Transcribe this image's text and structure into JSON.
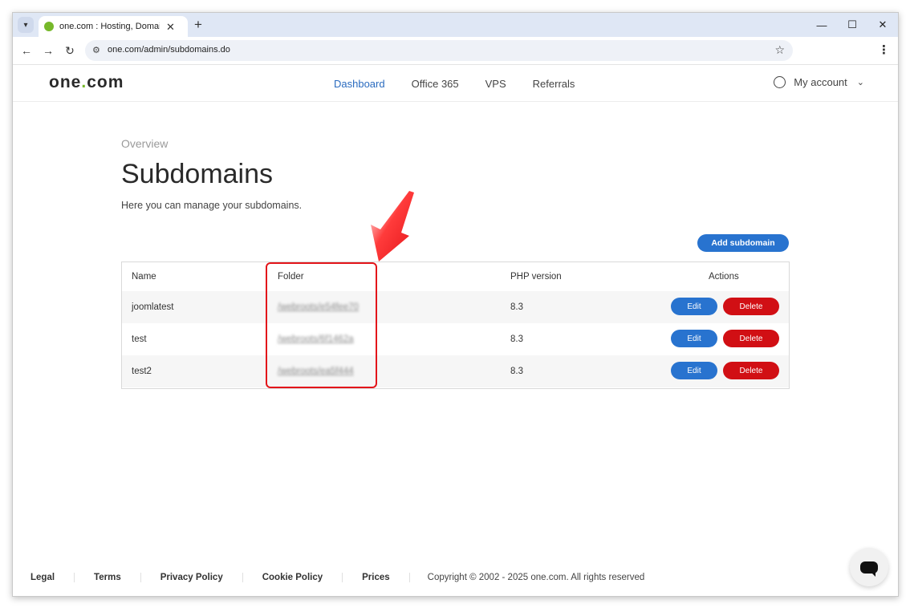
{
  "browser": {
    "tab_title": "one.com : Hosting, Domain, Em",
    "url": "one.com/admin/subdomains.do",
    "tab_menu_icon": "chevron-down-icon",
    "tab_close": "✕",
    "new_tab": "+",
    "back": "←",
    "forward": "→",
    "reload": "↻",
    "star": "☆",
    "kebab": "⋮",
    "site_info": "⚙",
    "minimize": "—",
    "maximize": "☐",
    "close": "✕"
  },
  "header": {
    "logo_part1": "one",
    "logo_dot": ".",
    "logo_part2": "com",
    "nav": [
      "Dashboard",
      "Office 365",
      "VPS",
      "Referrals"
    ],
    "active_nav": "Dashboard",
    "account_label": "My account",
    "chevron": "⌄"
  },
  "main": {
    "breadcrumb": "Overview",
    "title": "Subdomains",
    "description": "Here you can manage your subdomains.",
    "add_button": "Add subdomain",
    "columns": {
      "name": "Name",
      "folder": "Folder",
      "php": "PHP version",
      "actions": "Actions"
    },
    "rows": [
      {
        "name": "joomlatest",
        "folder": "/webroots/e54fee70",
        "php": "8.3",
        "edit": "Edit",
        "delete": "Delete"
      },
      {
        "name": "test",
        "folder": "/webroots/6f1462a",
        "php": "8.3",
        "edit": "Edit",
        "delete": "Delete"
      },
      {
        "name": "test2",
        "folder": "/webroots/ea5f444",
        "php": "8.3",
        "edit": "Edit",
        "delete": "Delete"
      }
    ],
    "colors": {
      "primary": "#2873cf",
      "danger": "#d10f14",
      "annotation": "#e3151a",
      "brand_green": "#76b82a"
    }
  },
  "footer": {
    "links": [
      "Legal",
      "Terms",
      "Privacy Policy",
      "Cookie Policy",
      "Prices"
    ],
    "copyright": "Copyright © 2002 - 2025 one.com. All rights reserved"
  }
}
